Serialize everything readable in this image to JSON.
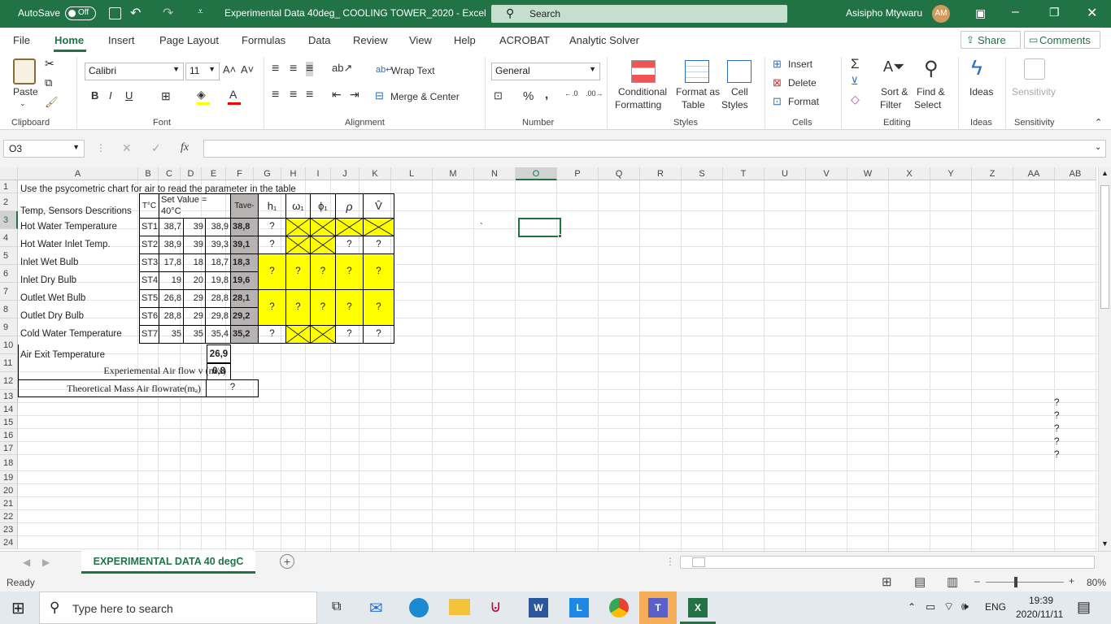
{
  "titlebar": {
    "autosave": "AutoSave",
    "autosave_state": "Off",
    "filename": "Experimental  Data 40deg_ COOLING TOWER_2020  -  Excel",
    "search": "Search",
    "user": "Asisipho Mtywaru",
    "user_initials": "AM"
  },
  "tabs": [
    "File",
    "Home",
    "Insert",
    "Page Layout",
    "Formulas",
    "Data",
    "Review",
    "View",
    "Help",
    "ACROBAT",
    "Analytic Solver"
  ],
  "share": "Share",
  "comments": "Comments",
  "ribbon": {
    "paste": "Paste",
    "font_name": "Calibri",
    "font_size": "11",
    "wrap_text": "Wrap Text",
    "merge_center": "Merge & Center",
    "number_format": "General",
    "conditional_formatting": "Conditional",
    "conditional_formatting2": "Formatting",
    "format_as_table": "Format as",
    "format_as_table2": "Table",
    "cell_styles": "Cell",
    "cell_styles2": "Styles",
    "insert": "Insert",
    "delete": "Delete",
    "format": "Format",
    "sort_filter": "Sort &",
    "sort_filter2": "Filter",
    "find_select": "Find &",
    "find_select2": "Select",
    "ideas": "Ideas",
    "sensitivity": "Sensitivity",
    "groups": {
      "clipboard": "Clipboard",
      "font": "Font",
      "alignment": "Alignment",
      "number": "Number",
      "styles": "Styles",
      "cells": "Cells",
      "editing": "Editing",
      "ideas": "Ideas",
      "sensitivity": "Sensitivity"
    }
  },
  "formula_bar": {
    "name_box": "O3",
    "fx": "fx",
    "content": ""
  },
  "columns": [
    "A",
    "B",
    "C",
    "D",
    "E",
    "F",
    "G",
    "H",
    "I",
    "J",
    "K",
    "L",
    "M",
    "N",
    "O",
    "P",
    "Q",
    "R",
    "S",
    "T",
    "U",
    "V",
    "W",
    "X",
    "Y",
    "Z",
    "AA",
    "AB"
  ],
  "rows": [
    "1",
    "2",
    "3",
    "4",
    "5",
    "6",
    "7",
    "8",
    "9",
    "10",
    "11",
    "12",
    "13",
    "14",
    "15",
    "16",
    "17",
    "18",
    "19",
    "20",
    "21",
    "22",
    "23",
    "24"
  ],
  "cells": {
    "a1": "Use the psycometric chart for air to read the  parameter in the table",
    "a2": "Temp, Sensors Descritions",
    "b2": "T°C",
    "c2a": "Set Value =",
    "c2b": "40°C",
    "f2": "Tave-",
    "g2": "h₁",
    "h2": "ω₁",
    "i2": "ϕ₁",
    "j2": "ρ",
    "k2": "V̂",
    "table": [
      {
        "label": "Hot Water Temperature",
        "sensor": "ST1",
        "c": "38,7",
        "d": "39",
        "e": "38,9",
        "f": "38,8"
      },
      {
        "label": "Hot Water Inlet Temp.",
        "sensor": "ST2",
        "c": "38,9",
        "d": "39",
        "e": "39,3",
        "f": "39,1"
      },
      {
        "label": "Inlet Wet Bulb",
        "sensor": "ST3",
        "c": "17,8",
        "d": "18",
        "e": "18,7",
        "f": "18,3"
      },
      {
        "label": "Inlet Dry Bulb",
        "sensor": "ST4",
        "c": "19",
        "d": "20",
        "e": "19,8",
        "f": "19,6"
      },
      {
        "label": "Outlet Wet Bulb",
        "sensor": "ST5",
        "c": "26,8",
        "d": "29",
        "e": "28,8",
        "f": "28,1"
      },
      {
        "label": "Outlet Dry Bulb",
        "sensor": "ST6",
        "c": "28,8",
        "d": "29",
        "e": "29,8",
        "f": "29,2"
      },
      {
        "label": "Cold Water Temperature",
        "sensor": "ST7",
        "c": "35",
        "d": "35",
        "e": "35,4",
        "f": "35,2"
      }
    ],
    "a10": "Air Exit Temperature",
    "f10": "26,9",
    "a11": "Experiemental Air flow v (m/s)",
    "f11": "0,8",
    "a12": "Theoretical Mass Air flowrate(mₐ)",
    "f12": "?",
    "q": "?",
    "tick": "`"
  },
  "sheet_tab": "EXPERIMENTAL DATA 40 degC",
  "status": {
    "ready": "Ready",
    "zoom": "80%"
  },
  "taskbar": {
    "search": "Type here to search",
    "time": "19:39",
    "date": "2020/11/11",
    "lang": "ENG"
  },
  "colors": {
    "excel_green": "#217346",
    "highlight": "#ffff00",
    "tave_gray": "#b7b3b3"
  }
}
